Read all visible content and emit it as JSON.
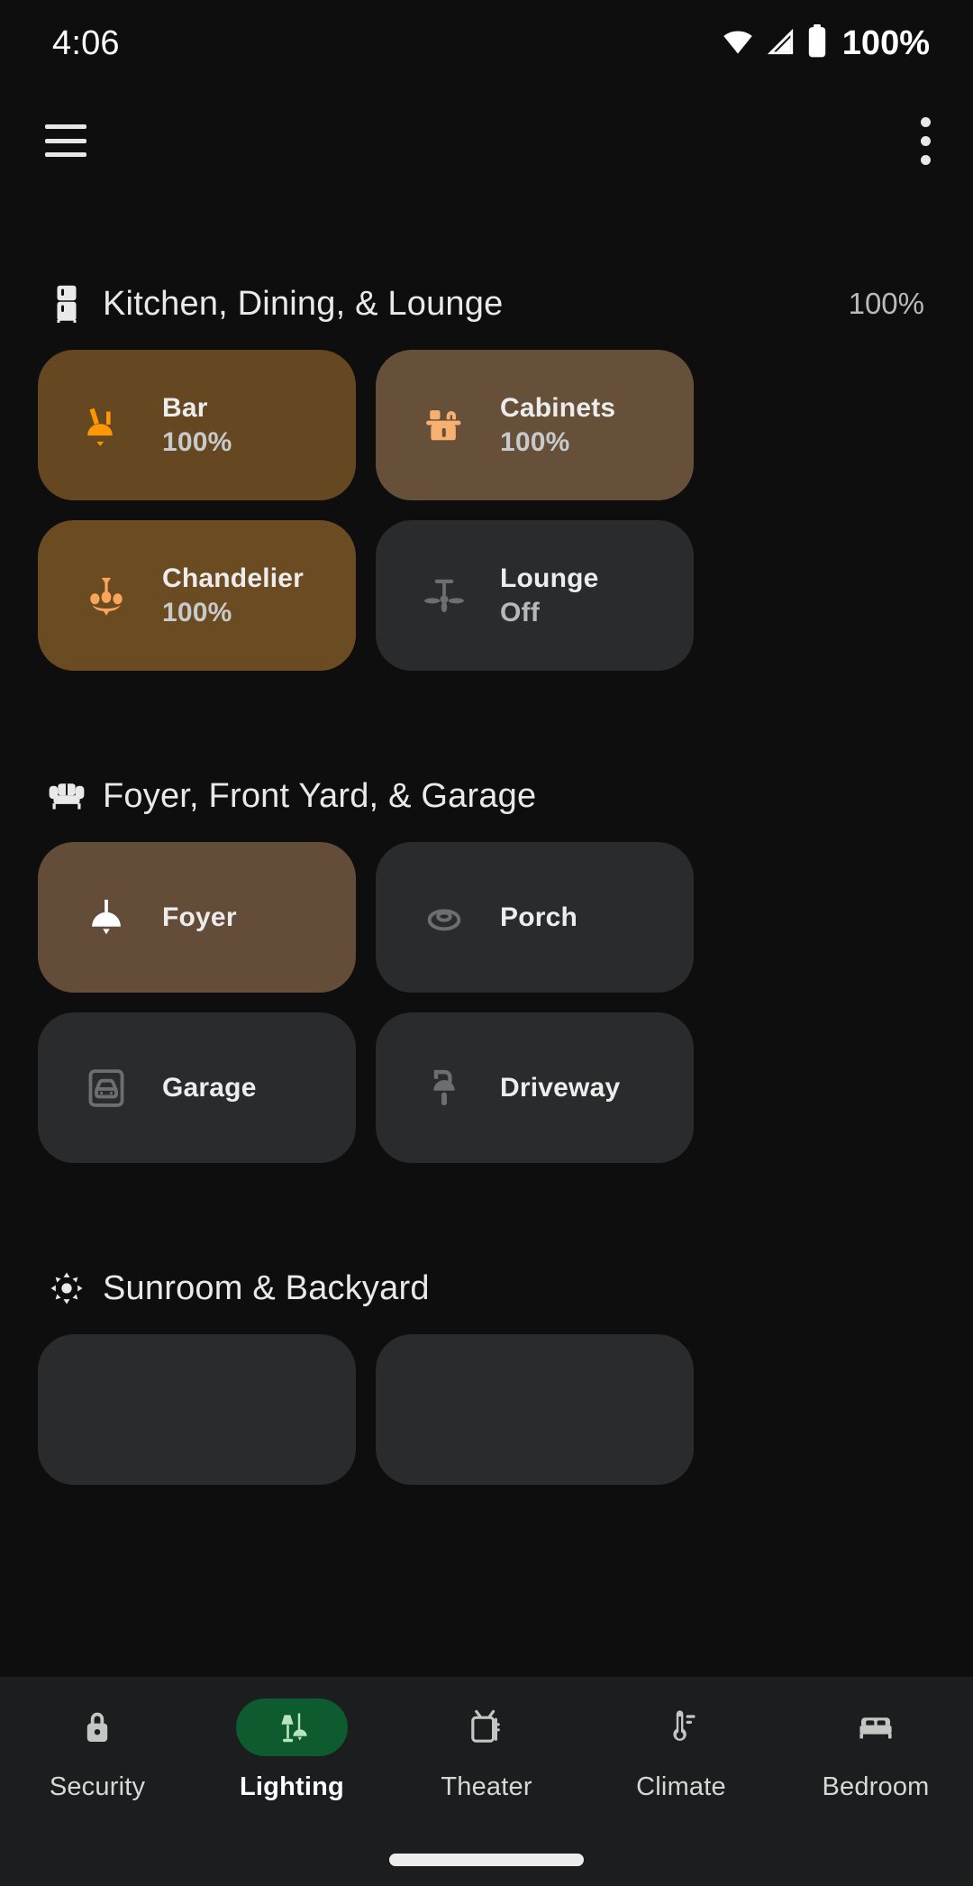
{
  "status_bar": {
    "time": "4:06",
    "battery_percent": "100%",
    "icons": [
      "wifi-icon",
      "cellular-signal-icon",
      "battery-icon"
    ]
  },
  "app_bar": {
    "menu_icon": "hamburger-menu-icon",
    "overflow_icon": "overflow-menu-icon"
  },
  "sections": [
    {
      "title": "Kitchen, Dining, & Lounge",
      "icon": "refrigerator-icon",
      "percent": "100%",
      "tiles": [
        {
          "name": "Bar",
          "state": "100%",
          "icon": "wall-sconce-light-icon",
          "on": true,
          "bg": "#654821",
          "icon_color": "#ff9800"
        },
        {
          "name": "Cabinets",
          "state": "100%",
          "icon": "under-cabinet-light-icon",
          "on": true,
          "bg": "#67503a",
          "icon_color": "#f8b070"
        },
        {
          "name": "Chandelier",
          "state": "100%",
          "icon": "chandelier-icon",
          "on": true,
          "bg": "#6b4b22",
          "icon_color": "#f9a65a"
        },
        {
          "name": "Lounge",
          "state": "Off",
          "icon": "ceiling-fan-icon",
          "on": false,
          "bg": "#2a2b2c",
          "icon_color": "#6d6e6f"
        }
      ]
    },
    {
      "title": "Foyer, Front Yard, & Garage",
      "icon": "sofa-icon",
      "percent": "",
      "tiles": [
        {
          "name": "Foyer",
          "state": "",
          "icon": "pendant-light-icon",
          "on": true,
          "bg": "#634d39",
          "icon_color": "#ffffff"
        },
        {
          "name": "Porch",
          "state": "",
          "icon": "ceiling-light-icon",
          "on": false,
          "bg": "#2a2b2c",
          "icon_color": "#6d6e6f"
        },
        {
          "name": "Garage",
          "state": "",
          "icon": "garage-door-icon",
          "on": false,
          "bg": "#2a2b2c",
          "icon_color": "#6d6e6f"
        },
        {
          "name": "Driveway",
          "state": "",
          "icon": "outdoor-lamp-icon",
          "on": false,
          "bg": "#2a2b2c",
          "icon_color": "#6d6e6f"
        }
      ]
    },
    {
      "title": "Sunroom & Backyard",
      "icon": "sun-brightness-icon",
      "percent": "",
      "tiles": [
        {
          "name": "",
          "state": "",
          "icon": "",
          "on": false,
          "bg": "#2a2b2c",
          "icon_color": "#6d6e6f"
        },
        {
          "name": "",
          "state": "",
          "icon": "",
          "on": false,
          "bg": "#2a2b2c",
          "icon_color": "#6d6e6f"
        }
      ]
    }
  ],
  "bottom_nav": {
    "active_index": 1,
    "active_color": "#0d5b2f",
    "items": [
      {
        "label": "Security",
        "icon": "lock-icon"
      },
      {
        "label": "Lighting",
        "icon": "lamp-icon"
      },
      {
        "label": "Theater",
        "icon": "television-icon"
      },
      {
        "label": "Climate",
        "icon": "thermometer-icon"
      },
      {
        "label": "Bedroom",
        "icon": "bed-icon"
      }
    ]
  }
}
